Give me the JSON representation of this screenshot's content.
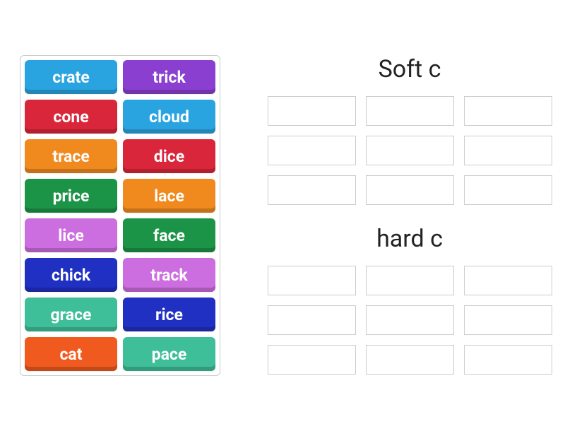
{
  "tiles": [
    {
      "label": "crate",
      "color": "#2aa4e0"
    },
    {
      "label": "trick",
      "color": "#8b3fd1"
    },
    {
      "label": "cone",
      "color": "#d9263a"
    },
    {
      "label": "cloud",
      "color": "#2aa4e0"
    },
    {
      "label": "trace",
      "color": "#f08a1f"
    },
    {
      "label": "dice",
      "color": "#d9263a"
    },
    {
      "label": "price",
      "color": "#1c9447"
    },
    {
      "label": "lace",
      "color": "#f08a1f"
    },
    {
      "label": "lice",
      "color": "#cc6de0"
    },
    {
      "label": "face",
      "color": "#1c9447"
    },
    {
      "label": "chick",
      "color": "#2030c2"
    },
    {
      "label": "track",
      "color": "#cc6de0"
    },
    {
      "label": "grace",
      "color": "#3fbf99"
    },
    {
      "label": "rice",
      "color": "#2030c2"
    },
    {
      "label": "cat",
      "color": "#f05a1f"
    },
    {
      "label": "pace",
      "color": "#3fbf99"
    }
  ],
  "groups": [
    {
      "title": "Soft c",
      "slots": 9
    },
    {
      "title": "hard c",
      "slots": 9
    }
  ]
}
